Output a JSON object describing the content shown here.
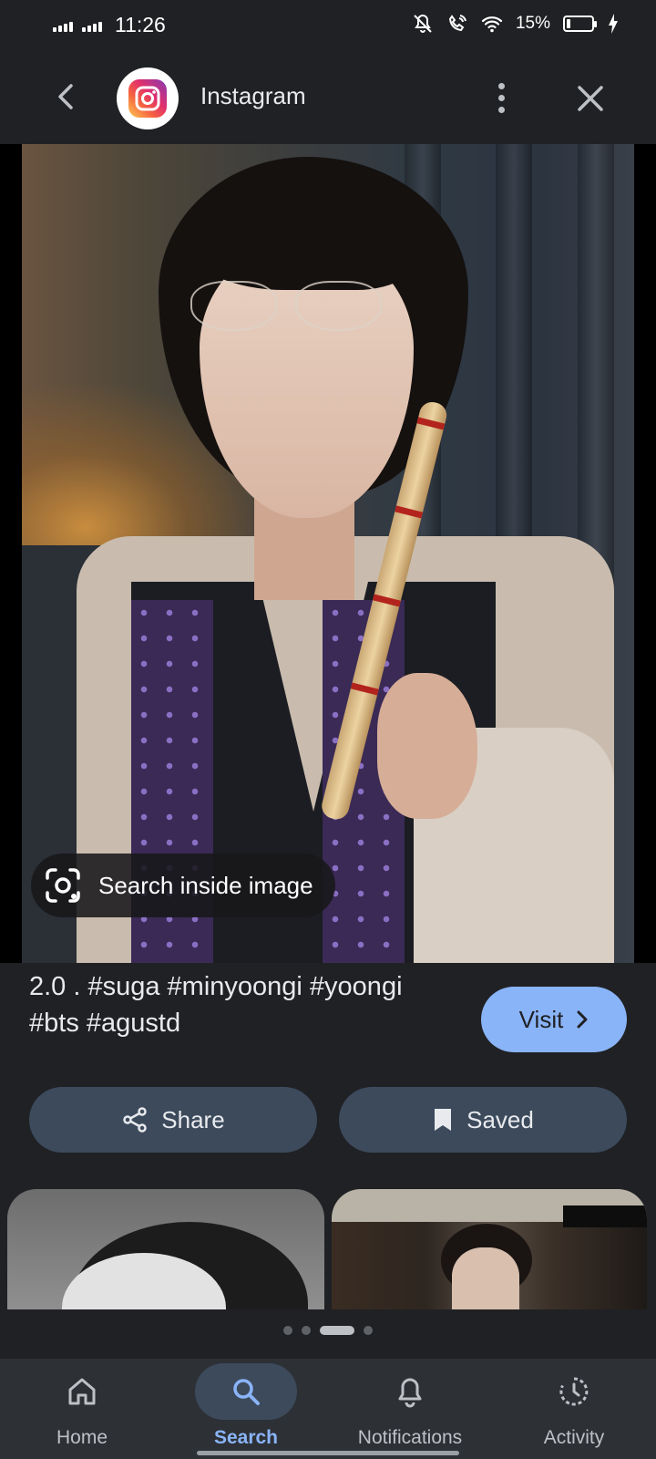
{
  "status_bar": {
    "time": "11:26",
    "battery_percent": "15%",
    "battery_level": 0.15,
    "icons": [
      "signal-icon",
      "signal-icon",
      "mute-icon",
      "wifi-calling-icon",
      "wifi-icon",
      "battery-icon",
      "charging-icon"
    ]
  },
  "header": {
    "source_name": "Instagram",
    "source_logo": "instagram-logo",
    "back_icon": "back-arrow-icon",
    "more_icon": "more-vert-icon",
    "close_icon": "close-icon"
  },
  "image": {
    "search_inside_label": "Search inside image",
    "search_inside_icon": "lens-icon"
  },
  "result": {
    "caption": "2.0 . #suga #minyoongi #yoongi #bts #agustd",
    "visit_label": "Visit"
  },
  "actions": {
    "share_label": "Share",
    "saved_label": "Saved"
  },
  "related": {
    "count": 2
  },
  "pager": {
    "total": 4,
    "active_index": 2
  },
  "bottom_nav": {
    "items": [
      {
        "label": "Home",
        "icon": "home-icon",
        "active": false
      },
      {
        "label": "Search",
        "icon": "search-icon",
        "active": true
      },
      {
        "label": "Notifications",
        "icon": "bell-icon",
        "active": false
      },
      {
        "label": "Activity",
        "icon": "activity-icon",
        "active": false
      }
    ]
  },
  "colors": {
    "background": "#202124",
    "accent": "#8ab4f8",
    "button_surface": "#3c4a5c",
    "nav_surface": "#2d3136"
  }
}
